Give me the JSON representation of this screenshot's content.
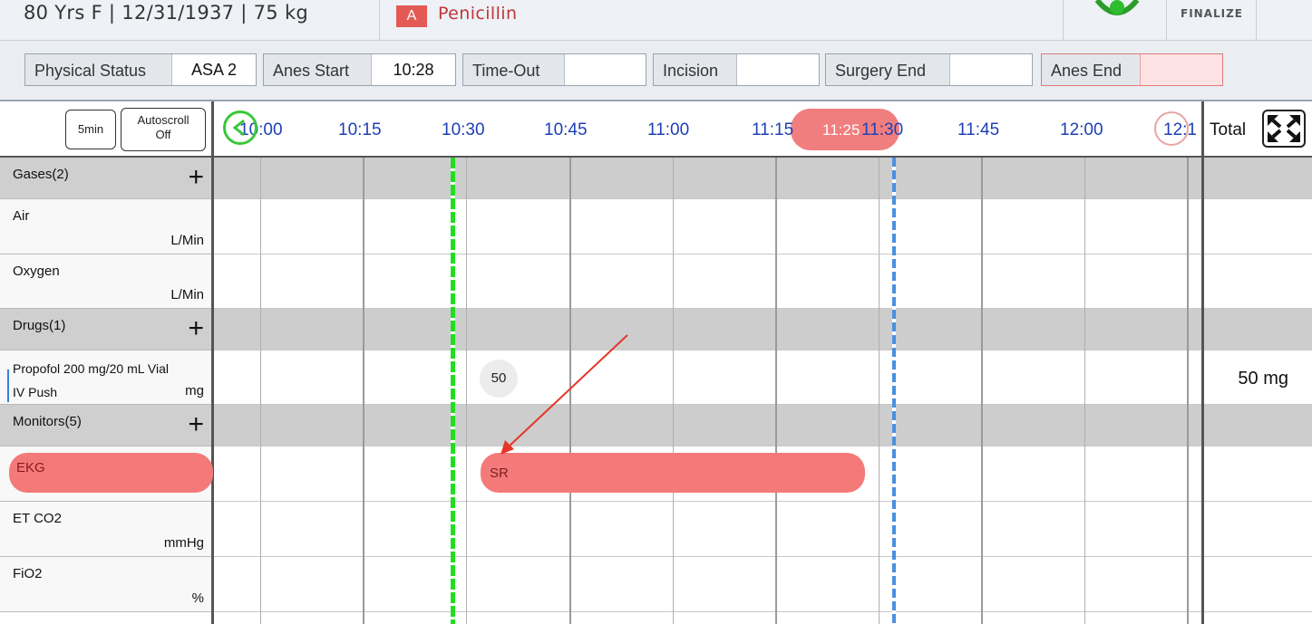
{
  "patient": {
    "info": "80 Yrs F | 12/31/1937 | 75 kg"
  },
  "allergy": {
    "badge": "A",
    "name": "Penicillin"
  },
  "header": {
    "finalize_label": "FINALIZE",
    "status_icon": "green-status-icon"
  },
  "events": [
    {
      "label": "Physical Status",
      "value": "ASA 2"
    },
    {
      "label": "Anes Start",
      "value": "10:28"
    },
    {
      "label": "Time-Out",
      "value": ""
    },
    {
      "label": "Incision",
      "value": ""
    },
    {
      "label": "Surgery End",
      "value": ""
    },
    {
      "label": "Anes End",
      "value": ""
    }
  ],
  "controls": {
    "interval": "5min",
    "autoscroll_line1": "Autoscroll",
    "autoscroll_line2": "Off"
  },
  "timeline": {
    "ticks": [
      "10:00",
      "10:15",
      "10:30",
      "10:45",
      "11:00",
      "11:15",
      "11:30",
      "11:45",
      "12:00",
      "12:1"
    ],
    "current_time": "11:25",
    "total_label": "Total",
    "expand_icon": "expand-icon",
    "nav_left_icon": "scroll-left-icon",
    "nav_right_icon": "scroll-right-icon"
  },
  "sections": {
    "gases": {
      "title": "Gases(2)"
    },
    "drugs": {
      "title": "Drugs(1)"
    },
    "monitors": {
      "title": "Monitors(5)"
    }
  },
  "rows": {
    "air": {
      "name": "Air",
      "unit": "L/Min"
    },
    "oxygen": {
      "name": "Oxygen",
      "unit": "L/Min"
    },
    "propofol": {
      "name": "Propofol 200 mg/20 mL Vial",
      "route": "IV Push",
      "unit": "mg",
      "dose": "50",
      "total": "50 mg"
    },
    "ekg": {
      "name": "EKG",
      "rhythm": "SR"
    },
    "etco2": {
      "name": "ET CO2",
      "unit": "mmHg"
    },
    "fio2": {
      "name": "FiO2",
      "unit": "%"
    }
  },
  "colors": {
    "accent_red": "#f47a7a",
    "anes_start_line": "#22dd22",
    "now_line": "#4a90e2",
    "tick_blue": "#1d3fb5"
  }
}
